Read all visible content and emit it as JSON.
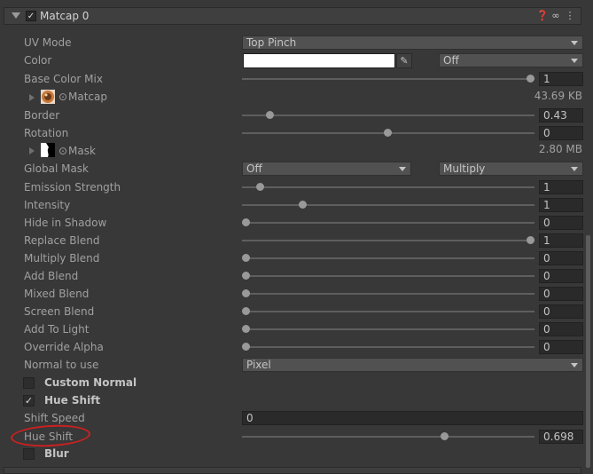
{
  "header": {
    "title": "Matcap 0",
    "checked": "✓",
    "icons": [
      "help-icon",
      "link-icon",
      "more-icon"
    ]
  },
  "uv_mode": {
    "label": "UV Mode",
    "value": "Top Pinch"
  },
  "color": {
    "label": "Color",
    "swatch": "#ffffff",
    "mode": "Off"
  },
  "base_color_mix": {
    "label": "Base Color Mix",
    "value": "1",
    "fraction": 1.0
  },
  "matcap_tex": {
    "label": "Matcap",
    "size": "43.69 KB"
  },
  "border": {
    "label": "Border",
    "value": "0.43",
    "fraction": 0.1
  },
  "rotation": {
    "label": "Rotation",
    "value": "0",
    "fraction": 0.5
  },
  "mask_tex": {
    "label": "Mask",
    "size": "2.80 MB"
  },
  "global_mask": {
    "label": "Global Mask",
    "value": "Off",
    "blend": "Multiply"
  },
  "emission_strength": {
    "label": "Emission Strength",
    "value": "1",
    "fraction": 0.05
  },
  "intensity": {
    "label": "Intensity",
    "value": "1",
    "fraction": 0.2
  },
  "hide_in_shadow": {
    "label": "Hide in Shadow",
    "value": "0",
    "fraction": 0
  },
  "replace_blend": {
    "label": "Replace Blend",
    "value": "1",
    "fraction": 1.0
  },
  "multiply_blend": {
    "label": "Multiply Blend",
    "value": "0",
    "fraction": 0
  },
  "add_blend": {
    "label": "Add Blend",
    "value": "0",
    "fraction": 0
  },
  "mixed_blend": {
    "label": "Mixed Blend",
    "value": "0",
    "fraction": 0
  },
  "screen_blend": {
    "label": "Screen Blend",
    "value": "0",
    "fraction": 0
  },
  "add_to_light": {
    "label": "Add To Light",
    "value": "0",
    "fraction": 0
  },
  "override_alpha": {
    "label": "Override Alpha",
    "value": "0",
    "fraction": 0
  },
  "normal_to_use": {
    "label": "Normal to use",
    "value": "Pixel"
  },
  "custom_normal": {
    "label": "Custom Normal",
    "checked": false
  },
  "hue_shift_toggle": {
    "label": "Hue Shift",
    "checked": true,
    "mark": "✓"
  },
  "shift_speed": {
    "label": "Shift Speed",
    "value": "0"
  },
  "hue_shift": {
    "label": "Hue Shift",
    "value": "0.698",
    "fraction": 0.698
  },
  "blur": {
    "label": "Blur"
  },
  "annotation_color": "#cc2020"
}
